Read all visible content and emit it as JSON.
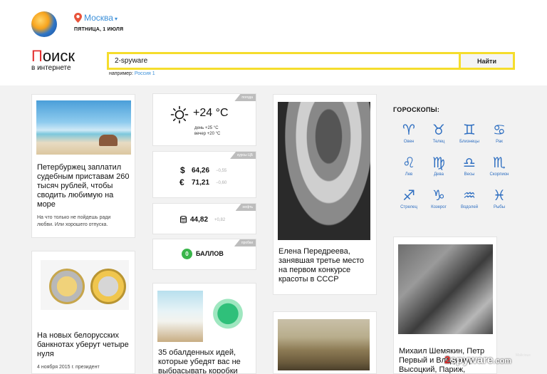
{
  "topbar": {
    "city": "Москва",
    "date": "ПЯТНИЦА, 1 ИЮЛЯ"
  },
  "search": {
    "logo_first": "П",
    "logo_rest": "оиск",
    "logo_sub": "в интернете",
    "value": "2-spyware",
    "button": "Найти",
    "example_label": "например:",
    "example_link": "Россия 1"
  },
  "news": [
    {
      "title": "Петербуржец заплатил судебным приставам 260 тысяч рублей, чтобы сводить любимую на море",
      "sub": "На что только не пойдешь ради любви. Или хорошего отпуска."
    },
    {
      "title": "На новых белорусских банкнотах уберут четыре нуля",
      "sub": "4 ноября 2015 г. президент"
    },
    {
      "title": "Елена Передреева, занявшая третье место на первом конкурсе красоты в СССР",
      "sub": ""
    },
    {
      "title": "35 обалденных идей, которые убедят вас не выбрасывать коробки",
      "sub": ""
    },
    {
      "title": "Михаил Шемякин, Петр Первый и Владимир Высоцкий, Париж,",
      "sub": ""
    }
  ],
  "weather": {
    "tag": "погода",
    "temp": "+24 °C",
    "day": "день +25 °C",
    "evening": "вечер +20 °C"
  },
  "currency": {
    "tag": "курсы ЦБ",
    "usd_symbol": "$",
    "usd": "64,26",
    "usd_change": "−0,55",
    "eur_symbol": "€",
    "eur": "71,21",
    "eur_change": "−0,60"
  },
  "oil": {
    "tag": "нефть",
    "value": "44,82",
    "change": "+0,82"
  },
  "traffic": {
    "tag": "пробки",
    "points": "0",
    "label": "БАЛЛОВ"
  },
  "horoscope": {
    "title": "ГОРОСКОПЫ:",
    "signs": [
      {
        "glyph": "♈",
        "name": "Овен"
      },
      {
        "glyph": "♉",
        "name": "Телец"
      },
      {
        "glyph": "♊",
        "name": "Близнецы"
      },
      {
        "glyph": "♋",
        "name": "Рак"
      },
      {
        "glyph": "♌",
        "name": "Лев"
      },
      {
        "glyph": "♍",
        "name": "Дева"
      },
      {
        "glyph": "♎",
        "name": "Весы"
      },
      {
        "glyph": "♏",
        "name": "Скорпион"
      },
      {
        "glyph": "♐",
        "name": "Стрелец"
      },
      {
        "glyph": "♑",
        "name": "Козерог"
      },
      {
        "glyph": "♒",
        "name": "Водолей"
      },
      {
        "glyph": "♓",
        "name": "Рыбы"
      }
    ]
  },
  "watermark": {
    "brand_mark": "2",
    "brand": "spyware",
    "suffix": ".com",
    "sub": "Malicious"
  },
  "colors": {
    "accent_yellow": "#f5dd2c",
    "link_blue": "#3b8fd9",
    "logo_red": "#e32f2f",
    "traffic_green": "#39b54a"
  },
  "icons": [
    "browser-logo-icon",
    "location-pin-icon",
    "chevron-down-icon",
    "sun-icon",
    "coins-stack-icon"
  ]
}
